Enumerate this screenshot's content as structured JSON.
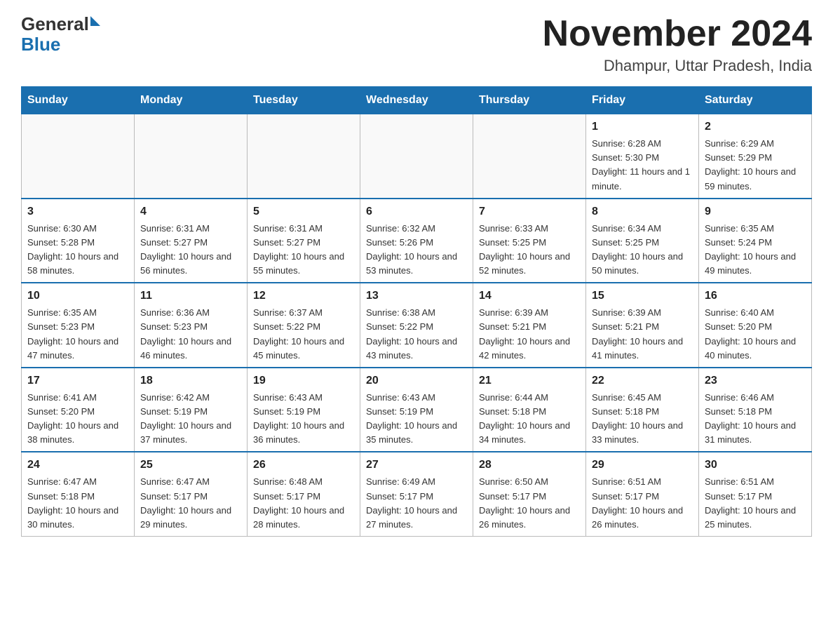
{
  "header": {
    "logo_general": "General",
    "logo_blue": "Blue",
    "month_title": "November 2024",
    "location": "Dhampur, Uttar Pradesh, India"
  },
  "weekdays": [
    "Sunday",
    "Monday",
    "Tuesday",
    "Wednesday",
    "Thursday",
    "Friday",
    "Saturday"
  ],
  "weeks": [
    [
      {
        "day": "",
        "info": ""
      },
      {
        "day": "",
        "info": ""
      },
      {
        "day": "",
        "info": ""
      },
      {
        "day": "",
        "info": ""
      },
      {
        "day": "",
        "info": ""
      },
      {
        "day": "1",
        "info": "Sunrise: 6:28 AM\nSunset: 5:30 PM\nDaylight: 11 hours and 1 minute."
      },
      {
        "day": "2",
        "info": "Sunrise: 6:29 AM\nSunset: 5:29 PM\nDaylight: 10 hours and 59 minutes."
      }
    ],
    [
      {
        "day": "3",
        "info": "Sunrise: 6:30 AM\nSunset: 5:28 PM\nDaylight: 10 hours and 58 minutes."
      },
      {
        "day": "4",
        "info": "Sunrise: 6:31 AM\nSunset: 5:27 PM\nDaylight: 10 hours and 56 minutes."
      },
      {
        "day": "5",
        "info": "Sunrise: 6:31 AM\nSunset: 5:27 PM\nDaylight: 10 hours and 55 minutes."
      },
      {
        "day": "6",
        "info": "Sunrise: 6:32 AM\nSunset: 5:26 PM\nDaylight: 10 hours and 53 minutes."
      },
      {
        "day": "7",
        "info": "Sunrise: 6:33 AM\nSunset: 5:25 PM\nDaylight: 10 hours and 52 minutes."
      },
      {
        "day": "8",
        "info": "Sunrise: 6:34 AM\nSunset: 5:25 PM\nDaylight: 10 hours and 50 minutes."
      },
      {
        "day": "9",
        "info": "Sunrise: 6:35 AM\nSunset: 5:24 PM\nDaylight: 10 hours and 49 minutes."
      }
    ],
    [
      {
        "day": "10",
        "info": "Sunrise: 6:35 AM\nSunset: 5:23 PM\nDaylight: 10 hours and 47 minutes."
      },
      {
        "day": "11",
        "info": "Sunrise: 6:36 AM\nSunset: 5:23 PM\nDaylight: 10 hours and 46 minutes."
      },
      {
        "day": "12",
        "info": "Sunrise: 6:37 AM\nSunset: 5:22 PM\nDaylight: 10 hours and 45 minutes."
      },
      {
        "day": "13",
        "info": "Sunrise: 6:38 AM\nSunset: 5:22 PM\nDaylight: 10 hours and 43 minutes."
      },
      {
        "day": "14",
        "info": "Sunrise: 6:39 AM\nSunset: 5:21 PM\nDaylight: 10 hours and 42 minutes."
      },
      {
        "day": "15",
        "info": "Sunrise: 6:39 AM\nSunset: 5:21 PM\nDaylight: 10 hours and 41 minutes."
      },
      {
        "day": "16",
        "info": "Sunrise: 6:40 AM\nSunset: 5:20 PM\nDaylight: 10 hours and 40 minutes."
      }
    ],
    [
      {
        "day": "17",
        "info": "Sunrise: 6:41 AM\nSunset: 5:20 PM\nDaylight: 10 hours and 38 minutes."
      },
      {
        "day": "18",
        "info": "Sunrise: 6:42 AM\nSunset: 5:19 PM\nDaylight: 10 hours and 37 minutes."
      },
      {
        "day": "19",
        "info": "Sunrise: 6:43 AM\nSunset: 5:19 PM\nDaylight: 10 hours and 36 minutes."
      },
      {
        "day": "20",
        "info": "Sunrise: 6:43 AM\nSunset: 5:19 PM\nDaylight: 10 hours and 35 minutes."
      },
      {
        "day": "21",
        "info": "Sunrise: 6:44 AM\nSunset: 5:18 PM\nDaylight: 10 hours and 34 minutes."
      },
      {
        "day": "22",
        "info": "Sunrise: 6:45 AM\nSunset: 5:18 PM\nDaylight: 10 hours and 33 minutes."
      },
      {
        "day": "23",
        "info": "Sunrise: 6:46 AM\nSunset: 5:18 PM\nDaylight: 10 hours and 31 minutes."
      }
    ],
    [
      {
        "day": "24",
        "info": "Sunrise: 6:47 AM\nSunset: 5:18 PM\nDaylight: 10 hours and 30 minutes."
      },
      {
        "day": "25",
        "info": "Sunrise: 6:47 AM\nSunset: 5:17 PM\nDaylight: 10 hours and 29 minutes."
      },
      {
        "day": "26",
        "info": "Sunrise: 6:48 AM\nSunset: 5:17 PM\nDaylight: 10 hours and 28 minutes."
      },
      {
        "day": "27",
        "info": "Sunrise: 6:49 AM\nSunset: 5:17 PM\nDaylight: 10 hours and 27 minutes."
      },
      {
        "day": "28",
        "info": "Sunrise: 6:50 AM\nSunset: 5:17 PM\nDaylight: 10 hours and 26 minutes."
      },
      {
        "day": "29",
        "info": "Sunrise: 6:51 AM\nSunset: 5:17 PM\nDaylight: 10 hours and 26 minutes."
      },
      {
        "day": "30",
        "info": "Sunrise: 6:51 AM\nSunset: 5:17 PM\nDaylight: 10 hours and 25 minutes."
      }
    ]
  ]
}
